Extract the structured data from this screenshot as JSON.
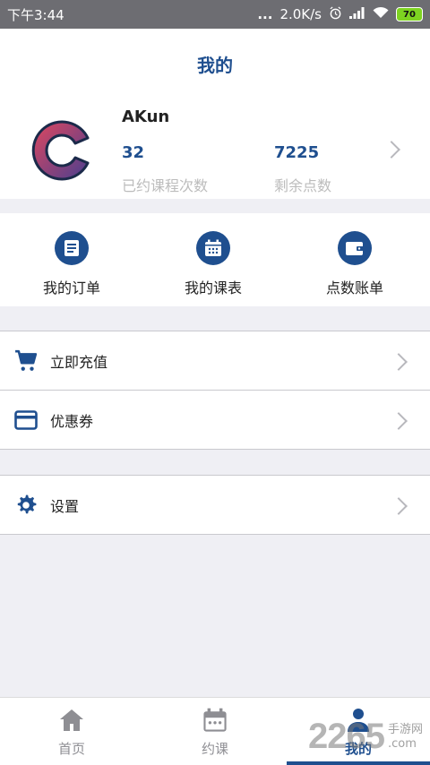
{
  "status_bar": {
    "time": "下午3:44",
    "dots": "...",
    "network_speed": "2.0K/s",
    "battery": "70",
    "icons": [
      "alarm-icon",
      "signal-icon",
      "wifi-icon",
      "battery-icon"
    ]
  },
  "header": {
    "title": "我的"
  },
  "profile": {
    "username": "AKun",
    "stats": [
      {
        "value": "32",
        "label": "已约课程次数"
      },
      {
        "value": "7225",
        "label": "剩余点数"
      }
    ]
  },
  "quick_actions": [
    {
      "label": "我的订单",
      "icon": "order-icon"
    },
    {
      "label": "我的课表",
      "icon": "calendar-icon"
    },
    {
      "label": "点数账单",
      "icon": "wallet-icon"
    }
  ],
  "menu": {
    "recharge": "立即充值",
    "coupon": "优惠券",
    "settings": "设置"
  },
  "tabs": [
    {
      "label": "首页",
      "icon": "home-icon"
    },
    {
      "label": "约课",
      "icon": "calendar-icon"
    },
    {
      "label": "我的",
      "icon": "user-icon",
      "active": true
    }
  ],
  "watermark": {
    "number": "2265",
    "line1": "手游网",
    "line2": ".com"
  },
  "colors": {
    "accent": "#1f4f8f",
    "background": "#efeff4",
    "muted": "#bcbcbc"
  }
}
